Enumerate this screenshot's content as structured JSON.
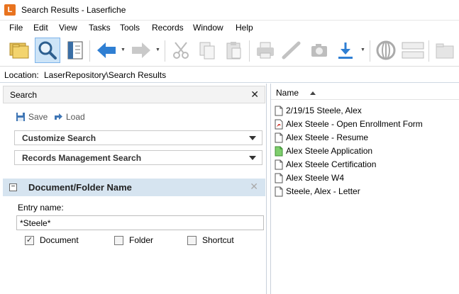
{
  "window": {
    "title": "Search Results - Laserfiche",
    "logo_letter": "L"
  },
  "menu": [
    "File",
    "Edit",
    "View",
    "Tasks",
    "Tools",
    "Records",
    "Window",
    "Help"
  ],
  "location": {
    "label": "Location:",
    "value": "LaserRepository\\Search Results"
  },
  "search_pane": {
    "title": "Search",
    "save_label": "Save",
    "load_label": "Load",
    "dropdowns": [
      "Customize Search",
      "Records Management Search"
    ],
    "section_title": "Document/Folder Name",
    "entry_label": "Entry name:",
    "entry_value": "*Steele*",
    "checkboxes": [
      {
        "label": "Document",
        "checked": true
      },
      {
        "label": "Folder",
        "checked": false
      },
      {
        "label": "Shortcut",
        "checked": false
      }
    ]
  },
  "results": {
    "column_header": "Name",
    "items": [
      {
        "name": "2/19/15 Steele, Alex",
        "icon": "document-icon"
      },
      {
        "name": "Alex Steele - Open Enrollment Form",
        "icon": "pdf-icon"
      },
      {
        "name": "Alex Steele - Resume",
        "icon": "document-icon"
      },
      {
        "name": "Alex Steele Application",
        "icon": "electronic-document-icon"
      },
      {
        "name": "Alex Steele Certification",
        "icon": "document-icon"
      },
      {
        "name": "Alex Steele W4",
        "icon": "document-icon"
      },
      {
        "name": "Steele, Alex - Letter",
        "icon": "document-icon"
      }
    ]
  },
  "colors": {
    "accent": "#2f7fd3",
    "logo": "#e8731f",
    "section_header": "#d6e4f0"
  }
}
